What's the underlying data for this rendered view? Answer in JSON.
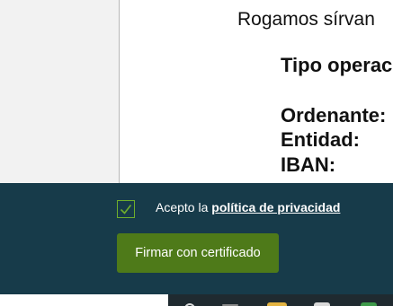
{
  "document": {
    "intro": "Rogamos sírvan",
    "operation_label": "Tipo operac",
    "ordering_label": "Ordenante:",
    "entity_label": "Entidad:",
    "iban_label": "IBAN:"
  },
  "consent": {
    "checked": true,
    "text_prefix": "Acepto la",
    "privacy_link": "política de privacidad",
    "sign_button": "Firmar con certificado"
  },
  "colors": {
    "consent_bar": "#173b4a",
    "checkbox_border": "#6fae2c",
    "button": "#4e7a19",
    "taskbar": "#1f2a30"
  },
  "taskbar": {
    "icons": [
      "search-icon",
      "taskbar-app-icon",
      "folder-icon",
      "document-icon",
      "spreadsheet-icon"
    ]
  }
}
